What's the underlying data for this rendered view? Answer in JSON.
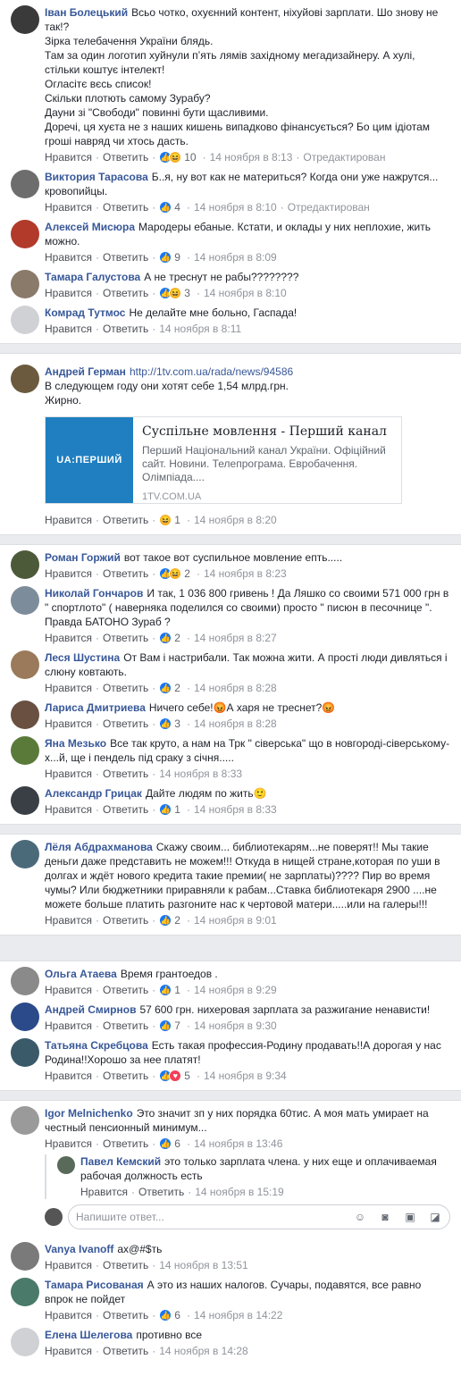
{
  "labels": {
    "like": "Нравится",
    "reply": "Ответить",
    "edited": "Отредактирован",
    "reply_placeholder": "Напишите ответ..."
  },
  "g1": [
    {
      "author": "Іван Болецький",
      "text": "Всьо чотко, охуєнний контент, ніхуйові зарплати. Шо знову не так!?\nЗірка телебачення України блядь.\nТам за один логотип хуйнули пʼять лямів західному мегадизайнеру. А хулі, стільки коштує інтелект!\nОгласітє вєсь список!\nСкільки плотють самому Зурабу?\nДауни зі \"Свободи\" повинні бути щасливими.\nДоречі, ця хуєта не з наших кишень випадково фінансується? Бо цим ідіотам гроші навряд чи хтось дасть.",
      "reactions": "10",
      "time": "14 ноября в 8:13",
      "edited": true
    },
    {
      "author": "Виктория Тарасова",
      "text": "Б..я, ну вот как не материться? Когда они уже нажрутся... кровопийцы.",
      "reactions": "4",
      "time": "14 ноября в 8:10",
      "edited": true
    },
    {
      "author": "Алексей Мисюра",
      "text": "Мародеры ебаные. Кстати, и оклады у них неплохие, жить можно.",
      "reactions": "9",
      "time": "14 ноября в 8:09",
      "edited": false
    },
    {
      "author": "Тамара Галустова",
      "text": "А не треснут не рабы????????",
      "reactions": "3",
      "time": "14 ноября в 8:10",
      "edited": false
    },
    {
      "author": "Комрад Тутмос",
      "text": "Не делайте мне больно, Гаспада!",
      "reactions": "",
      "time": "14 ноября в 8:11",
      "edited": false
    }
  ],
  "g2": {
    "author": "Андрей Герман",
    "url": "http://1tv.com.ua/rada/news/94586",
    "text": "В следующем году они хотят себе 1,54 млрд.грн.\nЖирно.",
    "card": {
      "logo": "UA:ПЕРШИЙ",
      "title": "Суспільне мовлення - Перший канал",
      "desc": "Перший Національний канал України. Офіційний сайт. Новини. Телепрограма. Евробачення. Олімпіада....",
      "domain": "1TV.COM.UA"
    },
    "reactions": "1",
    "time": "14 ноября в 8:20"
  },
  "g3": [
    {
      "author": "Роман Горжий",
      "text": "вот такое вот суспильное мовление епть.....",
      "reactions": "2",
      "time": "14 ноября в 8:23"
    },
    {
      "author": "Николай Гончаров",
      "text": "И так, 1 036 800 гривень ! Да Ляшко со своими 571 000 грн в \" спортлото\" ( наверняка поделился со своими) просто \" писюн в песочнице \". Правда БАТОНО Зураб ?",
      "reactions": "2",
      "time": "14 ноября в 8:27"
    },
    {
      "author": "Леся Шустина",
      "text": "От Вам і настрибали. Так можна жити. А прості люди дивляться і слюну ковтають.",
      "reactions": "2",
      "time": "14 ноября в 8:28"
    },
    {
      "author": "Лариса Дмитриева",
      "text": "Ничего себе!😡А харя не треснет?😡",
      "reactions": "3",
      "time": "14 ноября в 8:28"
    },
    {
      "author": "Яна Мезько",
      "text": "Все так круто, а нам на Трк \" сіверська\" що в новгороді-сіверському-х...й, ще і пендель під сраку з січня.....",
      "reactions": "",
      "time": "14 ноября в 8:33"
    },
    {
      "author": "Александр Грицак",
      "text": "Дайте людям по жить🙂",
      "reactions": "1",
      "time": "14 ноября в 8:33"
    }
  ],
  "g4": [
    {
      "author": "Лёля Абдрахманова",
      "text": "Скажу своим... библиотекарям...не поверят!! Мы такие деньги даже представить не можем!!! Откуда в нищей стране,которая по уши в долгах и ждёт нового кредита такие премии( не зарплаты)???? Пир во время чумы? Или бюджетники приравняли к рабам...Ставка библиотекаря 2900 ....не можете больше платить разгоните нас к чертовой матери.....или на галеры!!!",
      "reactions": "2",
      "time": "14 ноября в 9:01"
    }
  ],
  "g5": [
    {
      "author": "Ольга Атаева",
      "text": "Время грантоедов .",
      "reactions": "1",
      "time": "14 ноября в 9:29"
    },
    {
      "author": "Андрей Смирнов",
      "text": "57 600 грн. нихеровая зарплата за разжигание ненависти!",
      "reactions": "7",
      "time": "14 ноября в 9:30"
    },
    {
      "author": "Татьяна Скребцова",
      "text": "Есть такая профессия-Родину продавать!!А дорогая у нас Родина!!Хорошо за нее платят!",
      "reactions": "5",
      "time": "14 ноября в 9:34"
    }
  ],
  "g6": {
    "c1": {
      "author": "Igor Melnichenko",
      "text": "Это значит зп у них порядка 60тис. А моя мать умирает на честный пенсионный минимум...",
      "reactions": "6",
      "time": "14 ноября в 13:46"
    },
    "reply": {
      "author": "Павел Кемский",
      "text": "это только зарплата члена. у них еще и оплачиваемая рабочая должность есть",
      "reactions": "",
      "time": "14 ноября в 15:19"
    },
    "c2": {
      "author": "Vanya Ivanoff",
      "text": "ах@#$ть",
      "reactions": "",
      "time": "14 ноября в 13:51"
    },
    "c3": {
      "author": "Тамара Рисованая",
      "text": "А это из наших налогов. Сучары, подавятся, все равно впрок не пойдет",
      "reactions": "6",
      "time": "14 ноября в 14:22"
    },
    "c4": {
      "author": "Елена Шелегова",
      "text": "противно все",
      "reactions": "",
      "time": "14 ноября в 14:28"
    }
  },
  "colors": {
    "link": "#385898",
    "like": "#1877f2",
    "separator": "#e9ebee"
  }
}
